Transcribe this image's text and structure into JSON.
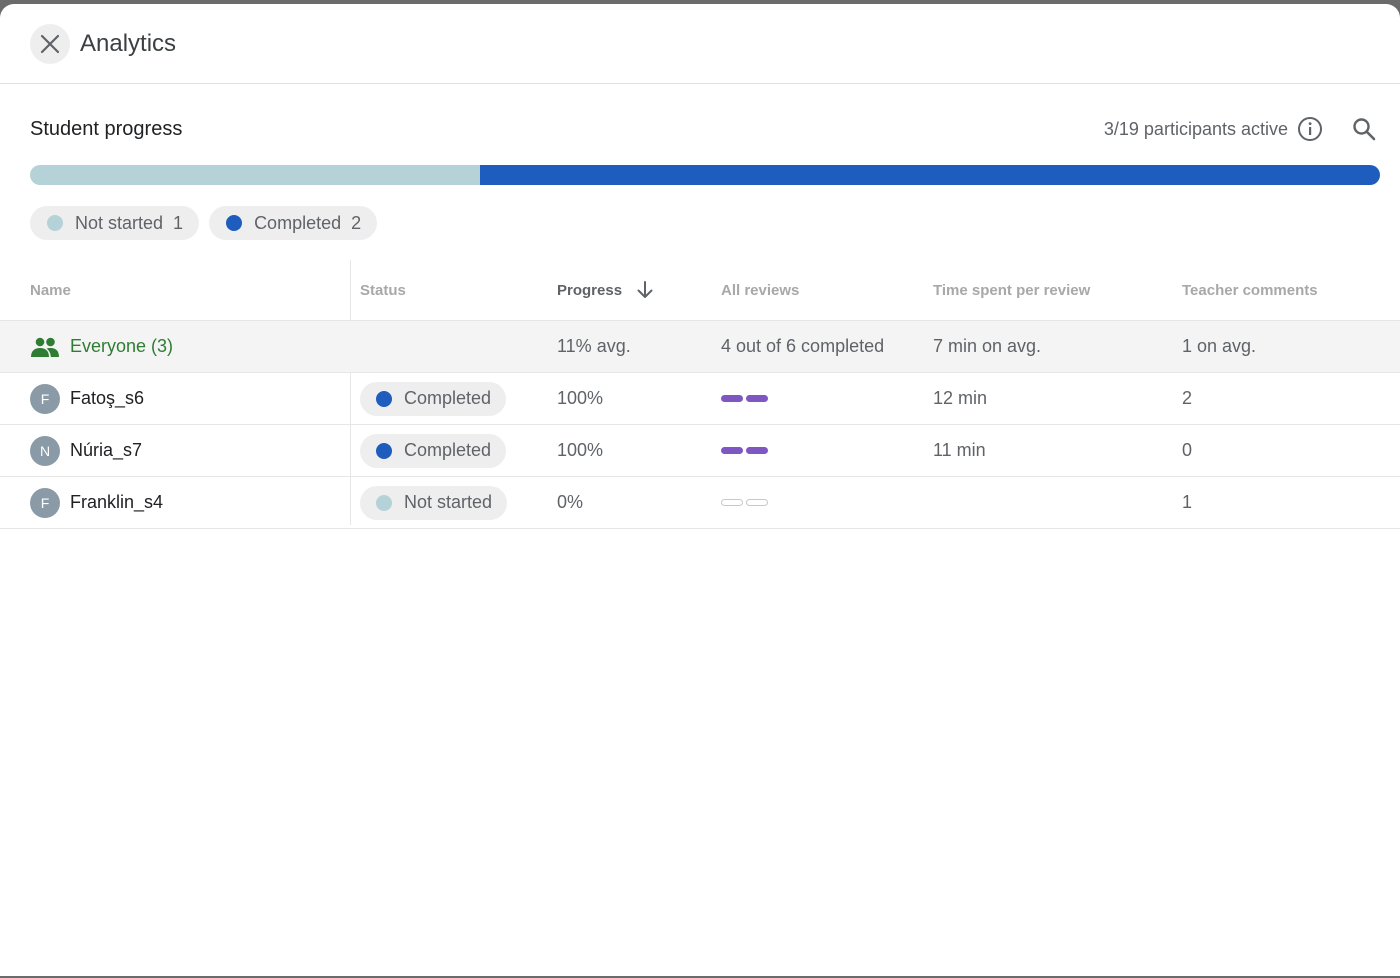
{
  "header": {
    "title": "Analytics"
  },
  "progress": {
    "title": "Student progress",
    "active_text": "3/19 participants active",
    "bar": [
      {
        "key": "not_started",
        "fraction": 0.3333,
        "color": "#b5d2d9"
      },
      {
        "key": "completed",
        "fraction": 0.6667,
        "color": "#1e5dbd"
      }
    ],
    "chips": [
      {
        "label": "Not started",
        "count": "1",
        "color": "#b5d2d9"
      },
      {
        "label": "Completed",
        "count": "2",
        "color": "#1e5dbd"
      }
    ]
  },
  "table": {
    "columns": {
      "name": "Name",
      "status": "Status",
      "progress": "Progress",
      "reviews": "All reviews",
      "time": "Time spent per review",
      "comments": "Teacher comments"
    },
    "summary": {
      "label": "Everyone (3)",
      "progress": "11% avg.",
      "reviews": "4 out of 6 completed",
      "time": "7 min on avg.",
      "comments": "1 on avg."
    },
    "rows": [
      {
        "initial": "F",
        "name": "Fatoş_s6",
        "status": "Completed",
        "status_color": "#1e5dbd",
        "progress": "100%",
        "reviews_done": 2,
        "reviews_total": 2,
        "time": "12 min",
        "comments": "2"
      },
      {
        "initial": "N",
        "name": "Núria_s7",
        "status": "Completed",
        "status_color": "#1e5dbd",
        "progress": "100%",
        "reviews_done": 2,
        "reviews_total": 2,
        "time": "11 min",
        "comments": "0"
      },
      {
        "initial": "F",
        "name": "Franklin_s4",
        "status": "Not started",
        "status_color": "#b5d2d9",
        "progress": "0%",
        "reviews_done": 0,
        "reviews_total": 2,
        "time": "",
        "comments": "1"
      }
    ]
  },
  "icons": {
    "close": "close-icon",
    "info": "info-icon",
    "search": "search-icon",
    "sort": "arrow-down-icon",
    "group": "group-icon"
  }
}
